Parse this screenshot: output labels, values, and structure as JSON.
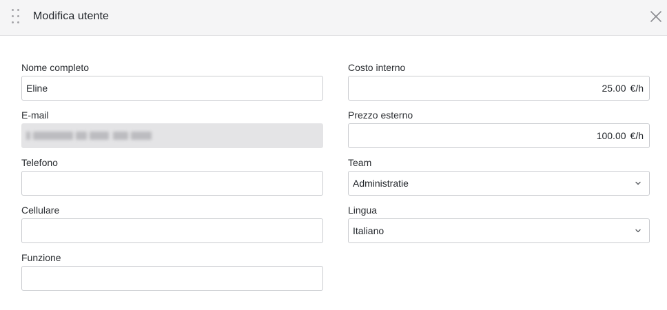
{
  "dialog": {
    "title": "Modifica utente"
  },
  "fields": {
    "full_name": {
      "label": "Nome completo",
      "value": "Eline"
    },
    "email": {
      "label": "E-mail",
      "value": ""
    },
    "phone": {
      "label": "Telefono",
      "value": ""
    },
    "mobile": {
      "label": "Cellulare",
      "value": ""
    },
    "role": {
      "label": "Funzione",
      "value": ""
    },
    "internal_cost": {
      "label": "Costo interno",
      "value": "25.00",
      "unit": "€/h"
    },
    "external_price": {
      "label": "Prezzo esterno",
      "value": "100.00",
      "unit": "€/h"
    },
    "team": {
      "label": "Team",
      "value": "Administratie"
    },
    "language": {
      "label": "Lingua",
      "value": "Italiano"
    }
  },
  "icons": {
    "drag": "drag-handle-icon",
    "close": "close-icon",
    "chevron": "chevron-down-icon"
  },
  "colors": {
    "header_bg": "#f5f5f6",
    "input_border": "#c9cbcf",
    "disabled_bg": "#e4e4e6"
  }
}
